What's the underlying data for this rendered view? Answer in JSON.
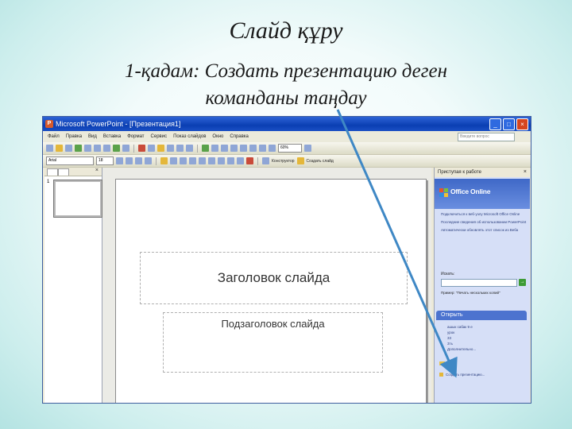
{
  "slide": {
    "title": "Слайд құру",
    "subtitle_line1": "1-қадам: Создать презентацию деген",
    "subtitle_line2": "команданы таңдау"
  },
  "window": {
    "title": "Microsoft PowerPoint - [Презентация1]",
    "buttons": [
      "_",
      "□",
      "×"
    ]
  },
  "menu": {
    "items": [
      "Файл",
      "Правка",
      "Вид",
      "Вставка",
      "Формат",
      "Сервис",
      "Показ слайдов",
      "Окно",
      "Справка"
    ],
    "help_placeholder": "Введите вопрос"
  },
  "toolbar": {
    "zoom": "60%",
    "font_name": "Arial",
    "font_size": "18",
    "designer_label": "Конструктор",
    "create_slide_label": "Создать слайд"
  },
  "thumbs": {
    "slide_number": "1",
    "close": "×"
  },
  "editor": {
    "title_placeholder": "Заголовок слайда",
    "subtitle_placeholder": "Подзаголовок слайда"
  },
  "task_pane": {
    "header": "Приступая к работе",
    "close": "×",
    "brand": "Office Online",
    "links": [
      "Подключиться к веб-узлу Microsoft Office Online",
      "Последние сведения об использовании PowerPoint",
      "Автоматически обновлять этот список из Веба"
    ],
    "search_label": "Искать:",
    "go": "→",
    "example": "Пример: \"Печать нескольких копий\"",
    "open_header": "Открыть",
    "files": [
      "ашык сабак 9 е",
      "урок",
      "33",
      "3ть",
      "Дополнительно..."
    ],
    "create": "Создать презентацию..."
  },
  "colors": {
    "arrow": "#3f88c5",
    "titlebar": "#0b3fb3",
    "task_pane_bg": "#d6dff7"
  }
}
